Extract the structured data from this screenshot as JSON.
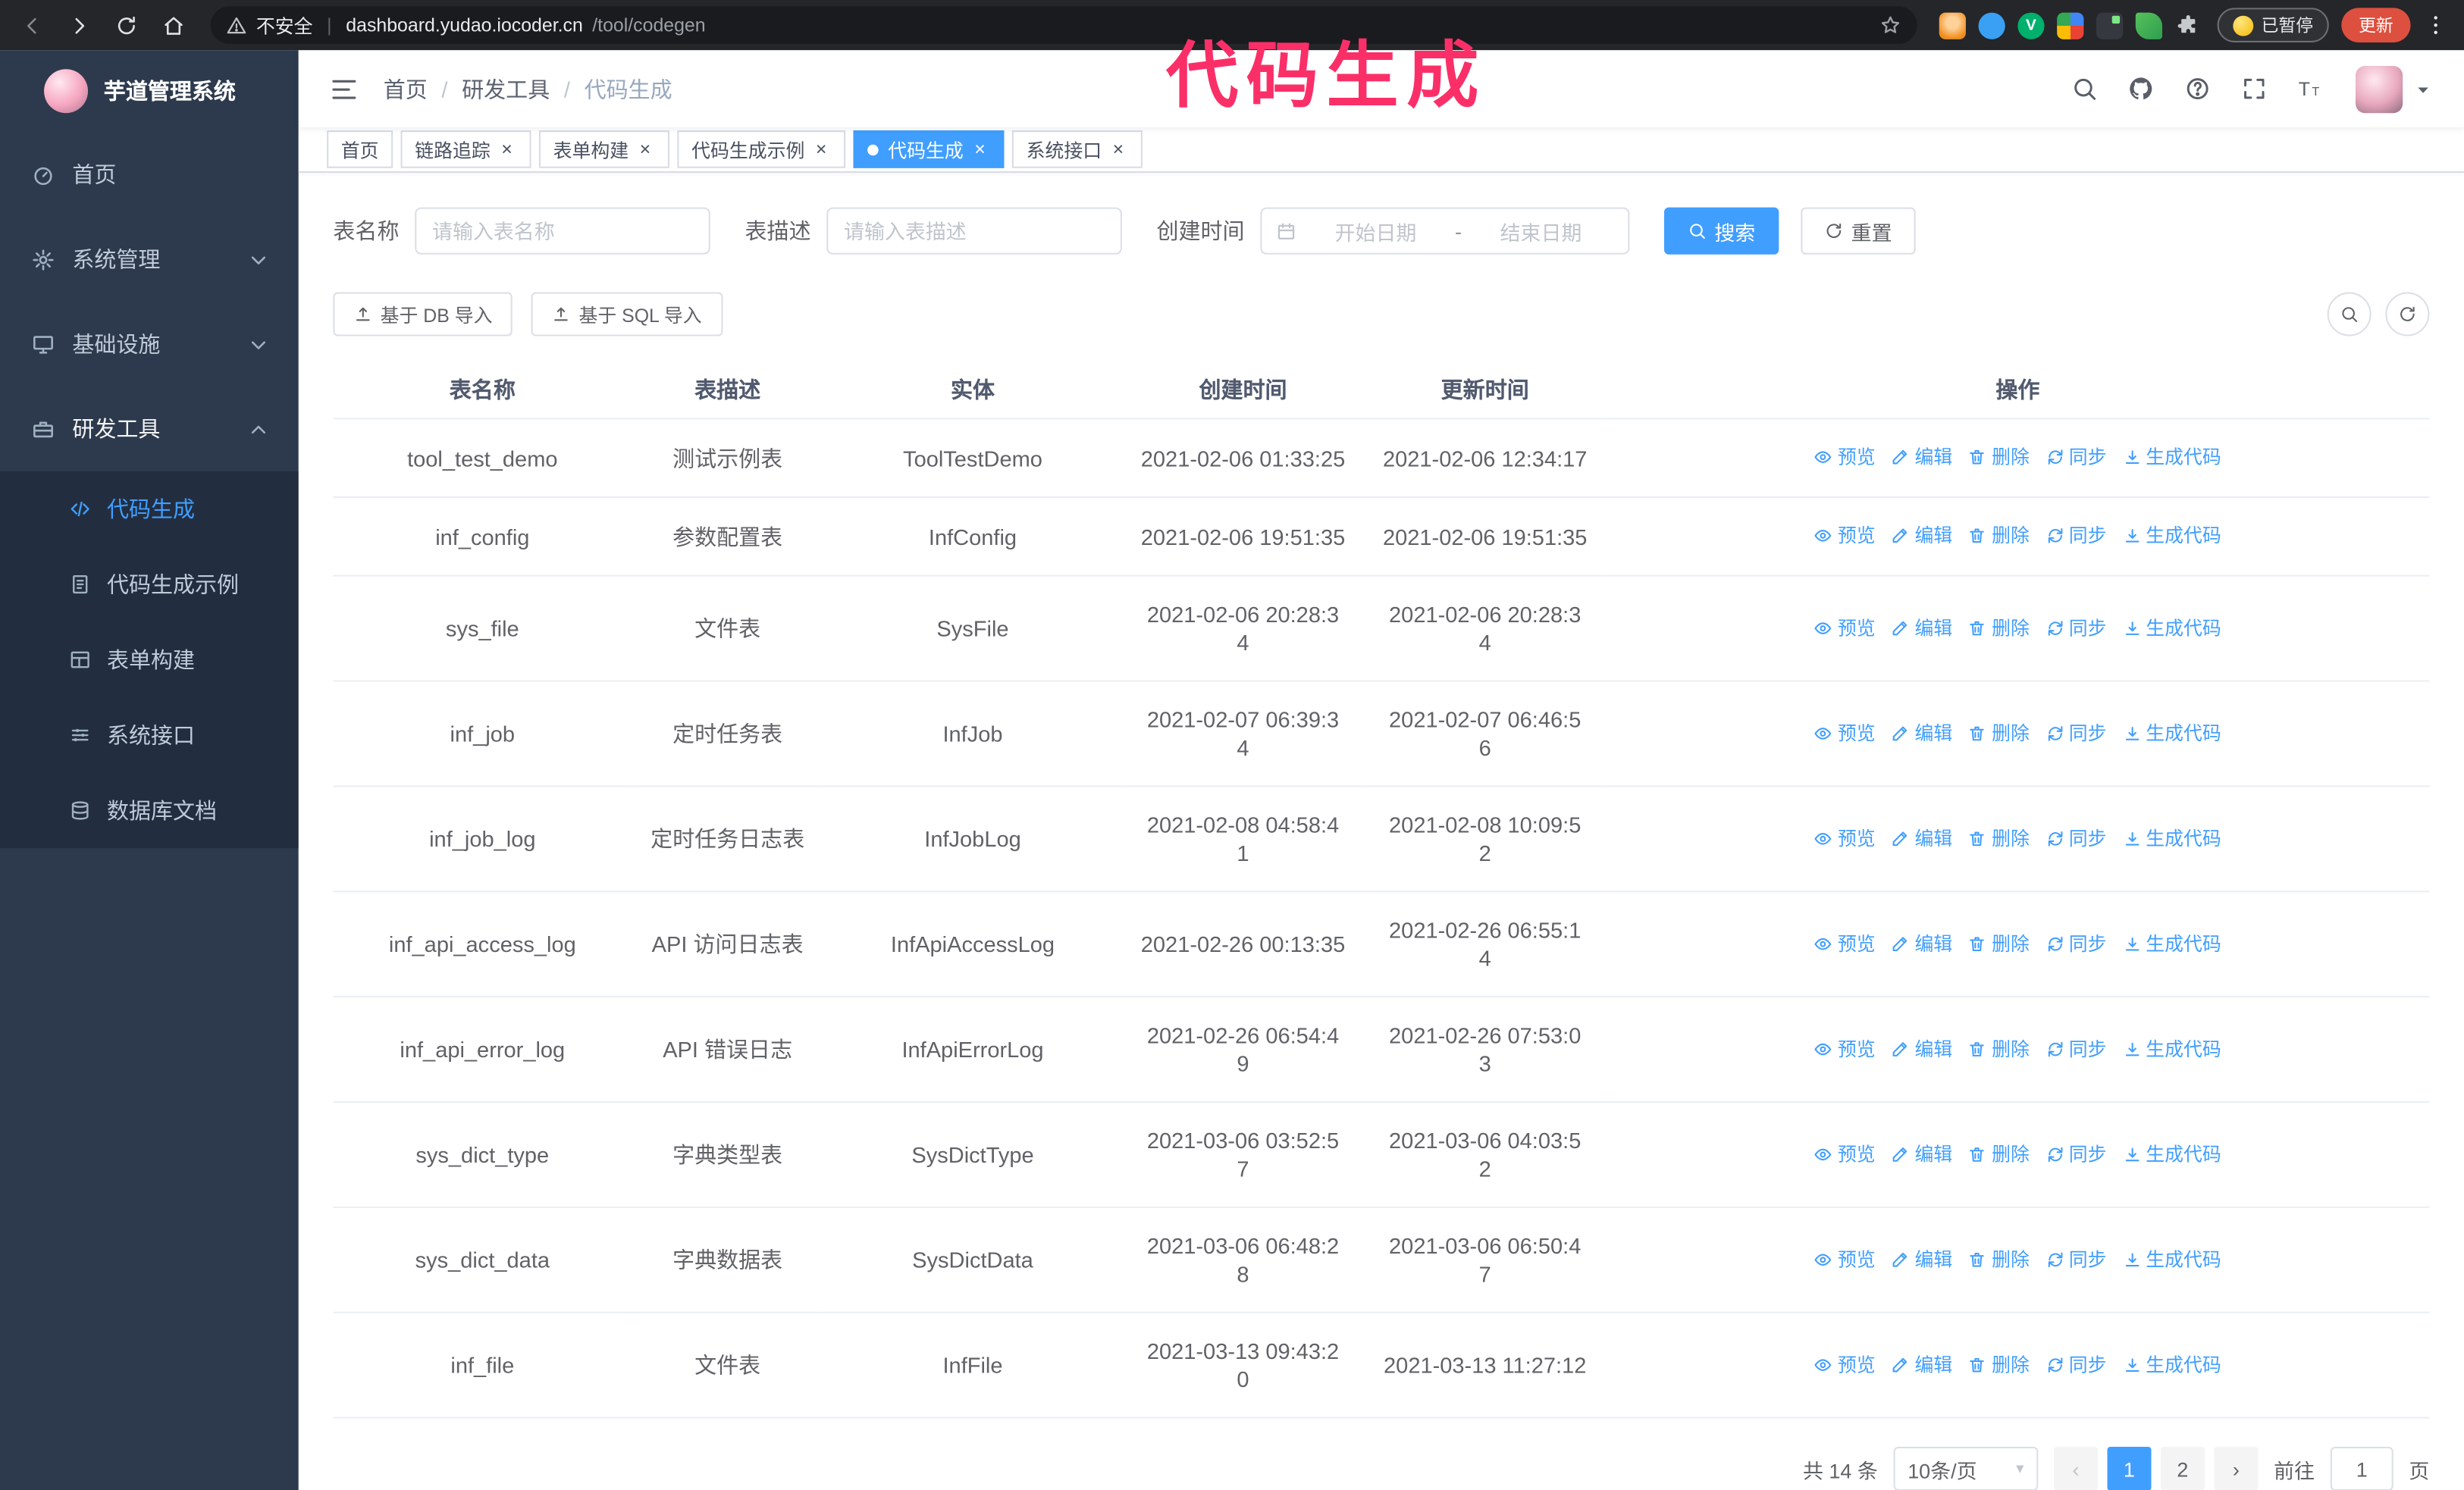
{
  "browser": {
    "nav_icons": [
      "back-icon",
      "forward-icon",
      "reload-icon",
      "home-icon"
    ],
    "security_label": "不安全",
    "url_host": "dashboard.yudao.iocoder.cn",
    "url_path": "/tool/codegen",
    "extension_icons": [
      "fox-ext-icon",
      "drop-ext-icon",
      "vue-ext-icon",
      "grid-ext-icon",
      "dark-ext-icon",
      "leaf-ext-icon",
      "puzzle-icon"
    ],
    "paused_badge": "已暂停",
    "update_button": "更新"
  },
  "annotation": {
    "text": "代码生成",
    "color": "#fb2f68"
  },
  "sidebar": {
    "logo_title": "芋道管理系统",
    "menu": [
      {
        "label": "首页",
        "icon": "dashboard-icon",
        "chevron": null,
        "active": false
      },
      {
        "label": "系统管理",
        "icon": "gear-icon",
        "chevron": "down",
        "active": false
      },
      {
        "label": "基础设施",
        "icon": "monitor-icon",
        "chevron": "down",
        "active": false
      },
      {
        "label": "研发工具",
        "icon": "toolbox-icon",
        "chevron": "up",
        "active": true
      }
    ],
    "submenu": [
      {
        "label": "代码生成",
        "icon": "code-icon",
        "active": true
      },
      {
        "label": "代码生成示例",
        "icon": "document-icon",
        "active": false
      },
      {
        "label": "表单构建",
        "icon": "form-icon",
        "active": false
      },
      {
        "label": "系统接口",
        "icon": "api-icon",
        "active": false
      },
      {
        "label": "数据库文档",
        "icon": "database-icon",
        "active": false
      }
    ]
  },
  "header": {
    "breadcrumb": [
      "首页",
      "研发工具",
      "代码生成"
    ],
    "breadcrumb_separator": "/",
    "icons": [
      "search-icon",
      "github-icon",
      "question-icon",
      "fullscreen-icon",
      "font-size-icon"
    ]
  },
  "tabs": [
    {
      "label": "首页",
      "closable": false,
      "active": false
    },
    {
      "label": "链路追踪",
      "closable": true,
      "active": false
    },
    {
      "label": "表单构建",
      "closable": true,
      "active": false
    },
    {
      "label": "代码生成示例",
      "closable": true,
      "active": false
    },
    {
      "label": "代码生成",
      "closable": true,
      "active": true
    },
    {
      "label": "系统接口",
      "closable": true,
      "active": false
    }
  ],
  "filters": {
    "table_name_label": "表名称",
    "table_name_placeholder": "请输入表名称",
    "table_desc_label": "表描述",
    "table_desc_placeholder": "请输入表描述",
    "create_time_label": "创建时间",
    "date_start_placeholder": "开始日期",
    "date_separator": "-",
    "date_end_placeholder": "结束日期",
    "search_button": "搜索",
    "reset_button": "重置"
  },
  "toolbar": {
    "import_db_button": "基于 DB 导入",
    "import_sql_button": "基于 SQL 导入"
  },
  "table": {
    "columns": [
      "表名称",
      "表描述",
      "实体",
      "创建时间",
      "更新时间",
      "操作"
    ],
    "actions": [
      {
        "key": "preview",
        "label": "预览",
        "icon": "eye-icon"
      },
      {
        "key": "edit",
        "label": "编辑",
        "icon": "edit-icon"
      },
      {
        "key": "delete",
        "label": "删除",
        "icon": "delete-icon"
      },
      {
        "key": "sync",
        "label": "同步",
        "icon": "sync-icon"
      },
      {
        "key": "generate",
        "label": "生成代码",
        "icon": "download-icon"
      }
    ],
    "rows": [
      {
        "name": "tool_test_demo",
        "desc": "测试示例表",
        "entity": "ToolTestDemo",
        "created": "2021-02-06 01:33:25",
        "updated": "2021-02-06 12:34:17"
      },
      {
        "name": "inf_config",
        "desc": "参数配置表",
        "entity": "InfConfig",
        "created": "2021-02-06 19:51:35",
        "updated": "2021-02-06 19:51:35"
      },
      {
        "name": "sys_file",
        "desc": "文件表",
        "entity": "SysFile",
        "created": "2021-02-06 20:28:3\n4",
        "updated": "2021-02-06 20:28:3\n4"
      },
      {
        "name": "inf_job",
        "desc": "定时任务表",
        "entity": "InfJob",
        "created": "2021-02-07 06:39:3\n4",
        "updated": "2021-02-07 06:46:5\n6"
      },
      {
        "name": "inf_job_log",
        "desc": "定时任务日志表",
        "entity": "InfJobLog",
        "created": "2021-02-08 04:58:4\n1",
        "updated": "2021-02-08 10:09:5\n2"
      },
      {
        "name": "inf_api_access_log",
        "desc": "API 访问日志表",
        "entity": "InfApiAccessLog",
        "created": "2021-02-26 00:13:35",
        "updated": "2021-02-26 06:55:1\n4"
      },
      {
        "name": "inf_api_error_log",
        "desc": "API 错误日志",
        "entity": "InfApiErrorLog",
        "created": "2021-02-26 06:54:4\n9",
        "updated": "2021-02-26 07:53:0\n3"
      },
      {
        "name": "sys_dict_type",
        "desc": "字典类型表",
        "entity": "SysDictType",
        "created": "2021-03-06 03:52:5\n7",
        "updated": "2021-03-06 04:03:5\n2"
      },
      {
        "name": "sys_dict_data",
        "desc": "字典数据表",
        "entity": "SysDictData",
        "created": "2021-03-06 06:48:2\n8",
        "updated": "2021-03-06 06:50:4\n7"
      },
      {
        "name": "inf_file",
        "desc": "文件表",
        "entity": "InfFile",
        "created": "2021-03-13 09:43:2\n0",
        "updated": "2021-03-13 11:27:12"
      }
    ]
  },
  "pagination": {
    "total_text": "共 14 条",
    "page_size": "10条/页",
    "pages": [
      "1",
      "2"
    ],
    "active_page": "1",
    "goto_label": "前往",
    "goto_value": "1",
    "page_suffix": "页"
  }
}
